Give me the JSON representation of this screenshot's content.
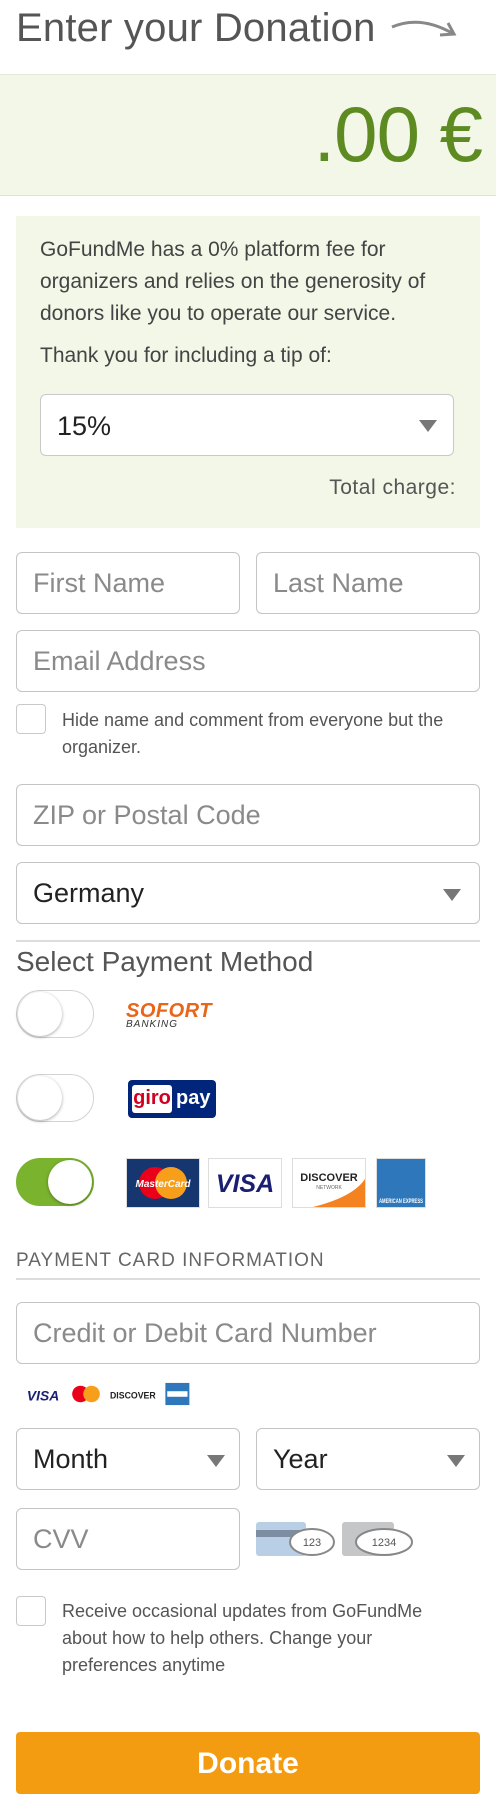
{
  "header": {
    "title": "Enter your Donation"
  },
  "amount": {
    "value": ".00 €"
  },
  "tip": {
    "info": "GoFundMe has a 0% platform fee for organizers and relies on the generosity of donors like you to operate our service.",
    "question": "Thank you for including a tip of:",
    "selected": "15%",
    "total_label": "Total charge:"
  },
  "form": {
    "first_name_placeholder": "First Name",
    "last_name_placeholder": "Last Name",
    "email_placeholder": "Email Address",
    "hide_name_label": "Hide name and comment from everyone but the organizer.",
    "zip_placeholder": "ZIP or Postal Code",
    "country_selected": "Germany"
  },
  "payment": {
    "section_title": "Select Payment Method",
    "methods": [
      {
        "name": "SOFORT",
        "sub": "BANKING",
        "enabled": false
      },
      {
        "name": "giropay",
        "part1": "giro",
        "part2": "pay",
        "enabled": false
      },
      {
        "name": "cards",
        "enabled": true
      }
    ],
    "card_brands": [
      "MasterCard",
      "VISA",
      "DISCOVER",
      "AMERICAN EXPRESS"
    ],
    "card_subtext": {
      "discover": "NETWORK"
    }
  },
  "card_info": {
    "title": "PAYMENT CARD INFORMATION",
    "card_number_placeholder": "Credit or Debit Card Number",
    "small_brands": [
      "VISA",
      "DISCOVER"
    ],
    "month_placeholder": "Month",
    "year_placeholder": "Year",
    "cvv_placeholder": "CVV",
    "cvv_hint_1": "123",
    "cvv_hint_2": "1234"
  },
  "updates": {
    "label": "Receive occasional updates from GoFundMe about how to help others. Change your preferences anytime"
  },
  "donate": {
    "label": "Donate"
  },
  "colors": {
    "accent_green": "#5e8a22",
    "toggle_on": "#7ab32e",
    "donate_orange": "#f49c11",
    "panel_bg": "#f2f7e8"
  }
}
